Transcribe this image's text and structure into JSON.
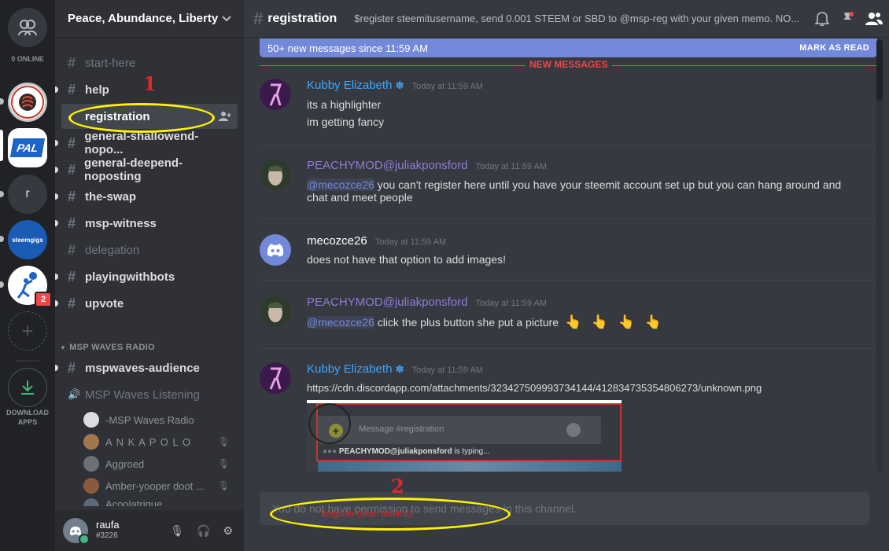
{
  "rail": {
    "online_label": "0 ONLINE",
    "servers": [
      {
        "name": "steemit-server",
        "letter": ""
      },
      {
        "name": "pal-server",
        "letter": "PAL"
      },
      {
        "name": "r-server",
        "letter": "r"
      },
      {
        "name": "steemgigs-server",
        "letter": "steemgigs"
      },
      {
        "name": "msp-waves-server",
        "letter": "",
        "badge": "2"
      }
    ],
    "download_label_1": "DOWNLOAD",
    "download_label_2": "APPS"
  },
  "guild": {
    "name": "Peace, Abundance, Liberty",
    "channels": [
      {
        "name": "start-here"
      },
      {
        "name": "help"
      },
      {
        "name": "registration"
      },
      {
        "name": "general-shallowend-nopo..."
      },
      {
        "name": "general-deepend-noposting"
      },
      {
        "name": "the-swap"
      },
      {
        "name": "msp-witness"
      },
      {
        "name": "delegation"
      },
      {
        "name": "playingwithbots"
      },
      {
        "name": "upvote"
      }
    ],
    "category": "MSP WAVES RADIO",
    "category_channel": "mspwaves-audience",
    "voice_channel": "MSP Waves Listening",
    "voice_users": [
      "-MSP Waves Radio",
      "A N K A P O L O",
      "Aggroed",
      "Amber-yooper doot ...",
      "Acoolatrique"
    ]
  },
  "user": {
    "name": "raufa",
    "tag": "#3226"
  },
  "chat": {
    "channel": "registration",
    "topic": "$register steemitusername, send 0.001 STEEM or SBD to @msp-reg with your given memo. NO...",
    "new_messages": "50+ new messages since 11:59 AM",
    "mark_as_read": "MARK AS READ",
    "divider": "NEW MESSAGES",
    "messages": [
      {
        "author": "Kubby Elizabeth",
        "time": "Today at 11:59 AM",
        "lines": [
          "its a highlighter",
          "im getting fancy"
        ]
      },
      {
        "author": "PEACHYMOD@juliakponsford",
        "time": "Today at 11:59 AM",
        "mention": "@mecozce26",
        "lines": [
          " you can't register here until you have your steemit account set up but you can hang around and",
          "chat and meet people"
        ]
      },
      {
        "author": "mecozce26",
        "time": "Today at 11:59 AM",
        "lines": [
          "does not have that option to add images!"
        ]
      },
      {
        "author": "PEACHYMOD@juliakponsford",
        "time": "Today at 11:59 AM",
        "mention": "@mecozce26",
        "lines": [
          " click the plus button she put a picture"
        ],
        "emoji": "👆 👆 👆 👆"
      },
      {
        "author": "Kubby Elizabeth",
        "time": "Today at 11:59 AM",
        "link": "https://cdn.discordapp.com/attachments/323427509993734144/412834735354806273/unknown.png"
      }
    ],
    "embed": {
      "placeholder": "Message #registration",
      "typing_user": "PEACHYMOD@juliakponsford",
      "typing_suffix": " is typing..."
    },
    "input_placeholder": "You do not have permission to send messages in this channel."
  },
  "annotations": {
    "label_1": "1",
    "label_2": "2",
    "handwritten": "$register (akun steemit)"
  }
}
